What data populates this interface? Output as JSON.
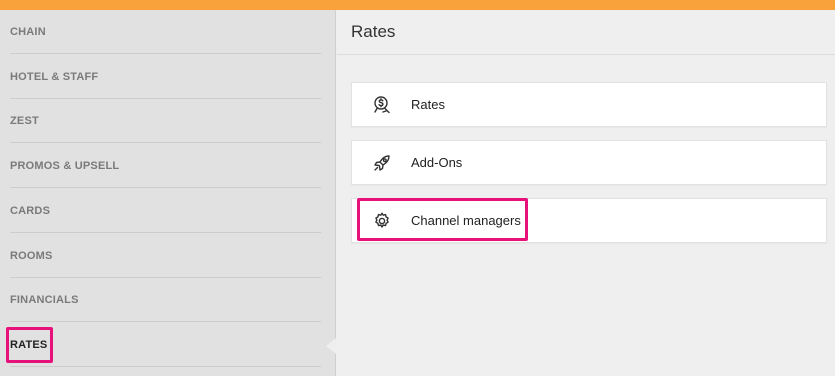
{
  "sidebar": {
    "items": [
      {
        "label": "CHAIN"
      },
      {
        "label": "HOTEL & STAFF"
      },
      {
        "label": "ZEST"
      },
      {
        "label": "PROMOS & UPSELL"
      },
      {
        "label": "CARDS"
      },
      {
        "label": "ROOMS"
      },
      {
        "label": "FINANCIALS"
      },
      {
        "label": "RATES",
        "active": true
      }
    ]
  },
  "main": {
    "title": "Rates",
    "cards": [
      {
        "label": "Rates",
        "icon": "rates-dollar-icon"
      },
      {
        "label": "Add-Ons",
        "icon": "rocket-icon"
      },
      {
        "label": "Channel managers",
        "icon": "gear-icon"
      }
    ]
  },
  "colors": {
    "accent_bar": "#f9a23b",
    "highlight": "#e8107a"
  }
}
